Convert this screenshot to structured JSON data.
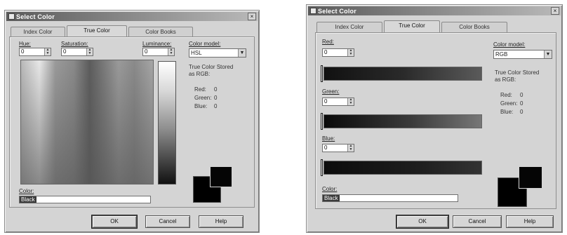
{
  "left_dialog": {
    "title": "Select Color",
    "close_label": "×",
    "tabs": [
      {
        "label": "Index Color"
      },
      {
        "label": "True Color"
      },
      {
        "label": "Color Books"
      }
    ],
    "hue_label": "Hue:",
    "hue_value": "0",
    "saturation_label": "Saturation:",
    "saturation_value": "0",
    "luminance_label": "Luminance:",
    "luminance_value": "0",
    "color_model_label": "Color model:",
    "color_model_value": "HSL",
    "info_line1": "True Color Stored",
    "info_line2": "as RGB:",
    "rgb": [
      {
        "label": "Red:",
        "value": "0"
      },
      {
        "label": "Green:",
        "value": "0"
      },
      {
        "label": "Blue:",
        "value": "0"
      }
    ],
    "color_label": "Color:",
    "color_value": "Black",
    "ok_label": "OK",
    "cancel_label": "Cancel",
    "help_label": "Help"
  },
  "right_dialog": {
    "title": "Select Color",
    "close_label": "×",
    "tabs": [
      {
        "label": "Index Color"
      },
      {
        "label": "True Color"
      },
      {
        "label": "Color Books"
      }
    ],
    "red_label": "Red:",
    "red_value": "0",
    "green_label": "Green:",
    "green_value": "0",
    "blue_label": "Blue:",
    "blue_value": "0",
    "color_model_label": "Color model:",
    "color_model_value": "RGB",
    "info_line1": "True Color Stored",
    "info_line2": "as RGB:",
    "rgb": [
      {
        "label": "Red:",
        "value": "0"
      },
      {
        "label": "Green:",
        "value": "0"
      },
      {
        "label": "Blue:",
        "value": "0"
      }
    ],
    "color_label": "Color:",
    "color_value": "Black",
    "ok_label": "OK",
    "cancel_label": "Cancel",
    "help_label": "Help"
  }
}
